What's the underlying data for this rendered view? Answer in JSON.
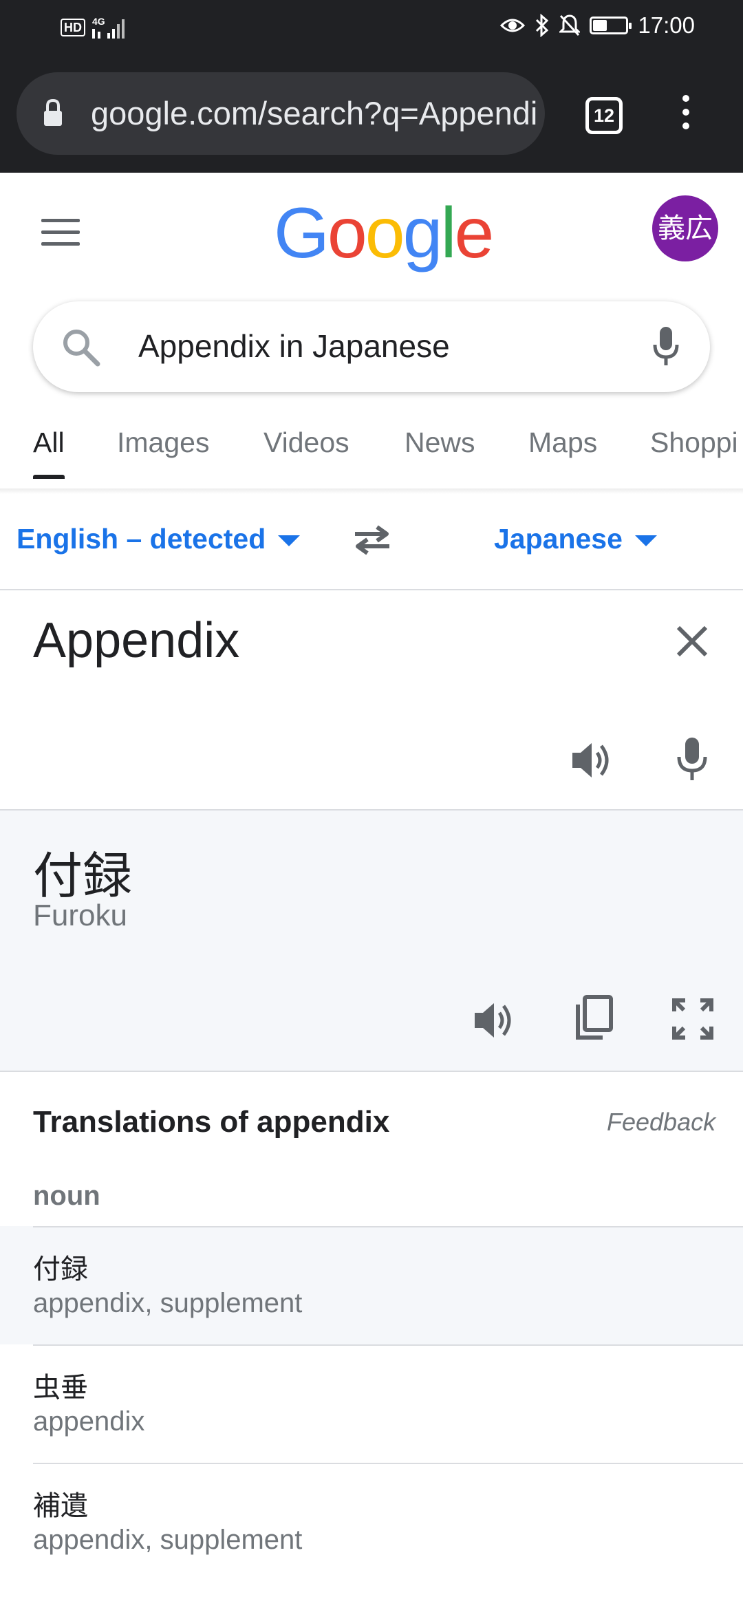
{
  "status_bar": {
    "hd": "HD",
    "network": "4G",
    "time": "17:00",
    "battery_level": 0.44
  },
  "browser": {
    "url": "google.com/search?q=Appendix+in+Japanese",
    "tab_count": "12"
  },
  "header": {
    "logo": [
      "G",
      "o",
      "o",
      "g",
      "l",
      "e"
    ],
    "logo_colors": [
      "#4285F4",
      "#EA4335",
      "#FBBC05",
      "#4285F4",
      "#34A853",
      "#EA4335"
    ],
    "avatar_text": "義広",
    "avatar_color": "#7b1fa2"
  },
  "search": {
    "query": "Appendix in Japanese"
  },
  "tabs": [
    "All",
    "Images",
    "Videos",
    "News",
    "Maps",
    "Shoppi"
  ],
  "translator": {
    "source_lang": "English – detected",
    "target_lang": "Japanese",
    "source_text": "Appendix",
    "result_text": "付録",
    "romanization": "Furoku"
  },
  "translations": {
    "title": "Translations of appendix",
    "feedback": "Feedback",
    "part_of_speech": "noun",
    "entries": [
      {
        "word": "付録",
        "meaning": "appendix, supplement"
      },
      {
        "word": "虫垂",
        "meaning": "appendix"
      },
      {
        "word": "補遺",
        "meaning": "appendix, supplement"
      }
    ]
  },
  "colors": {
    "accent": "#1a73e8",
    "chrome_dark": "#202124"
  }
}
